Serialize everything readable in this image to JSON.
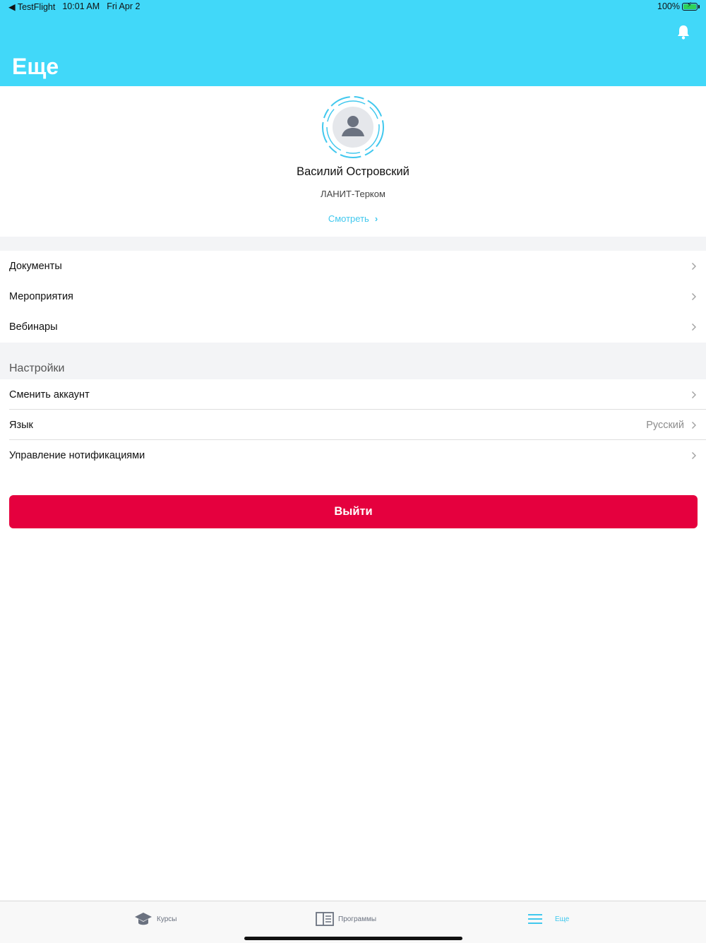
{
  "status_bar": {
    "back_app": "◀ TestFlight",
    "time": "10:01 AM",
    "date": "Fri Apr 2",
    "battery": "100%"
  },
  "header": {
    "title": "Еще",
    "bell_icon": "bell-icon",
    "background_color": "#41d8f9"
  },
  "profile": {
    "name": "Василий Островский",
    "organization": "ЛАНИТ-Терком",
    "view_link": "Смотреть",
    "avatar_icon": "person-icon"
  },
  "menu": {
    "items": [
      {
        "label": "Документы"
      },
      {
        "label": "Мероприятия"
      },
      {
        "label": "Вебинары"
      }
    ]
  },
  "settings": {
    "title": "Настройки",
    "items": [
      {
        "label": "Сменить аккаунт",
        "value": ""
      },
      {
        "label": "Язык",
        "value": "Русский"
      },
      {
        "label": "Управление нотификациями",
        "value": ""
      }
    ]
  },
  "logout": {
    "label": "Выйти",
    "color": "#e5003e"
  },
  "tabbar": {
    "tabs": [
      {
        "label": "Курсы",
        "icon": "graduation-cap-icon",
        "active": false
      },
      {
        "label": "Программы",
        "icon": "book-icon",
        "active": false
      },
      {
        "label": "Еще",
        "icon": "menu-icon",
        "active": true
      }
    ],
    "accent_color": "#41c8ee"
  }
}
